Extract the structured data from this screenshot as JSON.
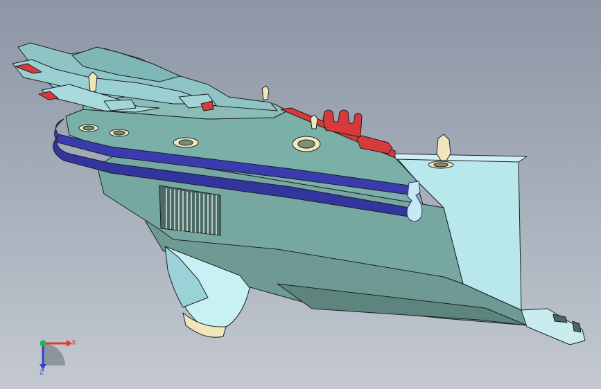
{
  "viewport": {
    "background_top": "#8d96a5",
    "background_bottom": "#c4c9d1"
  },
  "model": {
    "body_color": "#76a7a0",
    "body_light_color": "#b9e8ec",
    "seal_color": "#3a3cae",
    "accent_color": "#d63a3a",
    "edge_color": "#1a1f22",
    "cream_color": "#efe6bb"
  },
  "triad": {
    "x_label": "X",
    "z_label": "Z",
    "x_color": "#e23a2a",
    "y_color": "#28b34a",
    "z_color": "#2c3fd0"
  }
}
